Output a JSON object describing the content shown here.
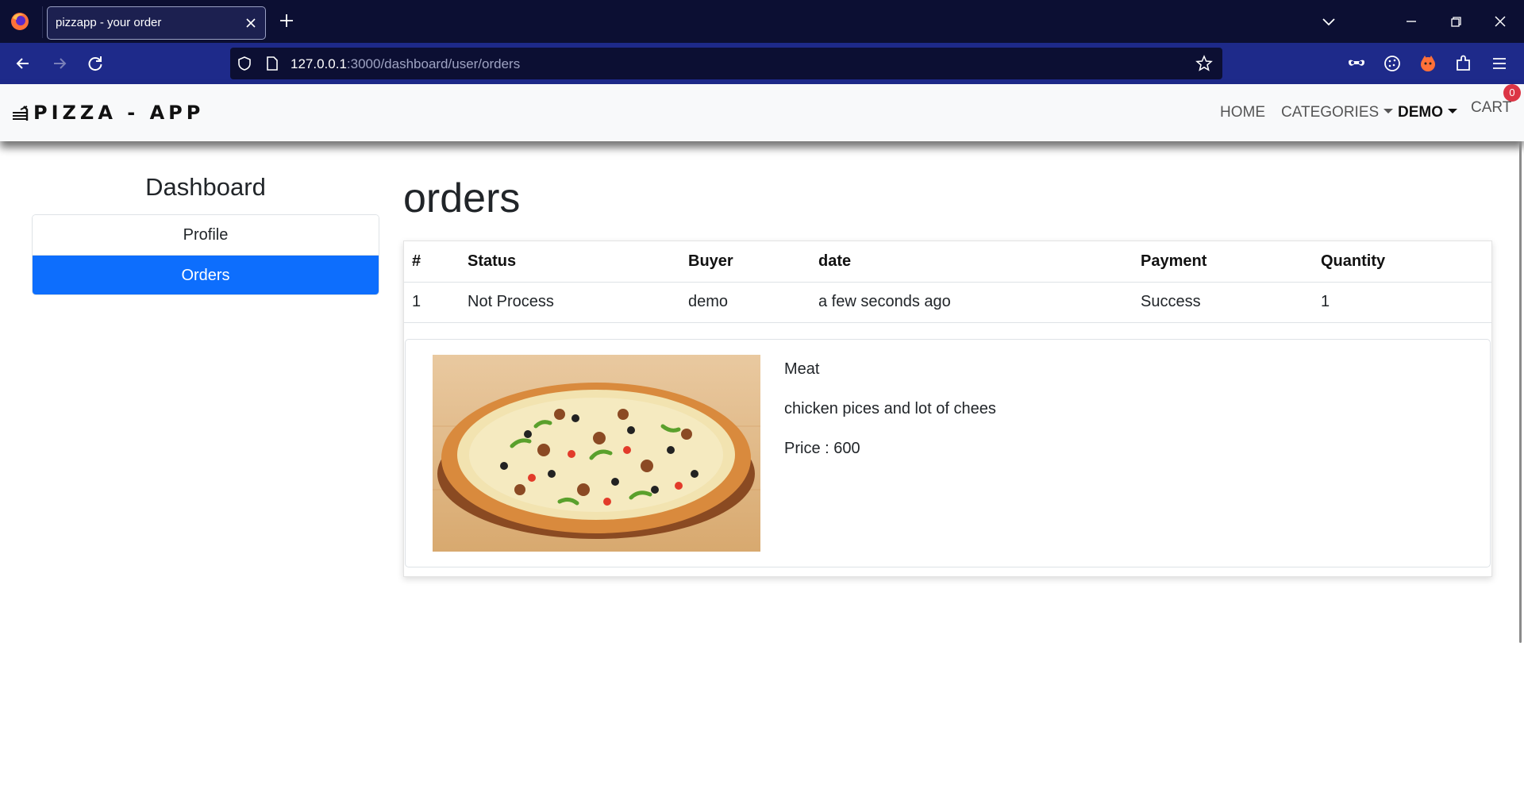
{
  "browser": {
    "tab_title": "pizzapp - your order",
    "url_host": "127.0.0.1",
    "url_path": ":3000/dashboard/user/orders"
  },
  "site": {
    "brand": "PIZZA - APP",
    "nav": {
      "home": "HOME",
      "categories": "CATEGORIES",
      "user": "DEMO",
      "cart": "CART",
      "cart_count": "0"
    }
  },
  "sidebar": {
    "title": "Dashboard",
    "items": [
      {
        "label": "Profile",
        "active": false
      },
      {
        "label": "Orders",
        "active": true
      }
    ]
  },
  "main": {
    "title": "orders",
    "table": {
      "headers": [
        "#",
        "Status",
        "Buyer",
        "date",
        "Payment",
        "Quantity"
      ],
      "rows": [
        [
          "1",
          "Not Process",
          "demo",
          "a few seconds ago",
          "Success",
          "1"
        ]
      ]
    },
    "product": {
      "name": "Meat",
      "description": "chicken pices and lot of chees",
      "price": "Price : 600"
    }
  },
  "colors": {
    "tabbar": "#0c0f33",
    "toolbar": "#1e2a8a",
    "active_item": "#0d6efd",
    "badge": "#dc3545"
  }
}
